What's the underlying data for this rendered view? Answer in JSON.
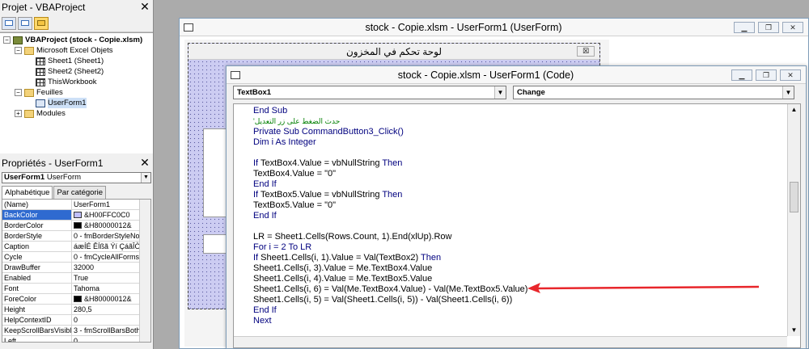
{
  "project_panel": {
    "title": "Projet - VBAProject",
    "tree": [
      {
        "label": "VBAProject (stock - Copie.xlsm)",
        "kind": "proj",
        "expander": "−",
        "indent": 4
      },
      {
        "label": "Microsoft Excel Objets",
        "kind": "folder",
        "expander": "−",
        "indent": 18
      },
      {
        "label": "Sheet1 (Sheet1)",
        "kind": "sheet",
        "expander": "",
        "indent": 44
      },
      {
        "label": "Sheet2 (Sheet2)",
        "kind": "sheet",
        "expander": "",
        "indent": 44
      },
      {
        "label": "ThisWorkbook",
        "kind": "sheet",
        "expander": "",
        "indent": 44
      },
      {
        "label": "Feuilles",
        "kind": "folder",
        "expander": "−",
        "indent": 18
      },
      {
        "label": "UserForm1",
        "kind": "form",
        "expander": "",
        "indent": 44
      },
      {
        "label": "Modules",
        "kind": "folder",
        "expander": "+",
        "indent": 18
      }
    ]
  },
  "properties_panel": {
    "title": "Propriétés - UserForm1",
    "object_name": "UserForm1",
    "object_type": "UserForm",
    "tabs": [
      "Alphabétique",
      "Par catégorie"
    ],
    "rows": [
      {
        "k": "(Name)",
        "v": "UserForm1",
        "swatch": ""
      },
      {
        "k": "BackColor",
        "v": "&H00FFC0C0",
        "swatch": "#c0c0ff"
      },
      {
        "k": "BorderColor",
        "v": "&H80000012&",
        "swatch": "#000000"
      },
      {
        "k": "BorderStyle",
        "v": "0 - fmBorderStyleNo",
        "swatch": ""
      },
      {
        "k": "Caption",
        "v": "áæÍÉ ÊÍßã Ýí ÇáãÎÒ",
        "swatch": ""
      },
      {
        "k": "Cycle",
        "v": "0 - fmCycleAllForms",
        "swatch": ""
      },
      {
        "k": "DrawBuffer",
        "v": "32000",
        "swatch": ""
      },
      {
        "k": "Enabled",
        "v": "True",
        "swatch": ""
      },
      {
        "k": "Font",
        "v": "Tahoma",
        "swatch": ""
      },
      {
        "k": "ForeColor",
        "v": "&H80000012&",
        "swatch": "#000000"
      },
      {
        "k": "Height",
        "v": "280,5",
        "swatch": ""
      },
      {
        "k": "HelpContextID",
        "v": "0",
        "swatch": ""
      },
      {
        "k": "KeepScrollBarsVisible",
        "v": "3 - fmScrollBarsBoth",
        "swatch": ""
      },
      {
        "k": "Left",
        "v": "0",
        "swatch": ""
      }
    ]
  },
  "form_window": {
    "title": "stock - Copie.xlsm - UserForm1 (UserForm)",
    "form_caption": "لوحة تحكم في المخزون",
    "close_glyph": "☒"
  },
  "code_window": {
    "title": "stock - Copie.xlsm - UserForm1 (Code)",
    "object_dropdown": "TextBox1",
    "procedure_dropdown": "Change",
    "lines": [
      {
        "t": "End Sub",
        "c": "kw"
      },
      {
        "t": "'حدث الضغط على زر التعديل",
        "c": "cm"
      },
      {
        "t": "Private Sub CommandButton3_Click()",
        "c": "kw"
      },
      {
        "t": "Dim i As Integer",
        "c": "kw"
      },
      {
        "t": "",
        "c": ""
      },
      {
        "t": "If TextBox4.Value = vbNullString Then",
        "c": "mix"
      },
      {
        "t": "TextBox4.Value = \"0\"",
        "c": ""
      },
      {
        "t": "End If",
        "c": "kw"
      },
      {
        "t": "If TextBox5.Value = vbNullString Then",
        "c": "mix"
      },
      {
        "t": "TextBox5.Value = \"0\"",
        "c": ""
      },
      {
        "t": "End If",
        "c": "kw"
      },
      {
        "t": "",
        "c": ""
      },
      {
        "t": "LR = Sheet1.Cells(Rows.Count, 1).End(xlUp).Row",
        "c": ""
      },
      {
        "t": "For i = 2 To LR",
        "c": "kw"
      },
      {
        "t": "If Sheet1.Cells(i, 1).Value = Val(TextBox2) Then",
        "c": "mix"
      },
      {
        "t": "Sheet1.Cells(i, 3).Value = Me.TextBox4.Value",
        "c": ""
      },
      {
        "t": "Sheet1.Cells(i, 4).Value = Me.TextBox5.Value",
        "c": ""
      },
      {
        "t": "Sheet1.Cells(i, 6) = Val(Me.TextBox4.Value) - Val(Me.TextBox5.Value)",
        "c": ""
      },
      {
        "t": "Sheet1.Cells(i, 5) = Val(Sheet1.Cells(i, 5)) - Val(Sheet1.Cells(i, 6))",
        "c": ""
      },
      {
        "t": "End If",
        "c": "kw"
      },
      {
        "t": "Next",
        "c": "kw"
      }
    ]
  },
  "colors": {
    "annotation_arrow": "#e8262b",
    "keyword": "#00007f",
    "comment": "#007f00"
  }
}
